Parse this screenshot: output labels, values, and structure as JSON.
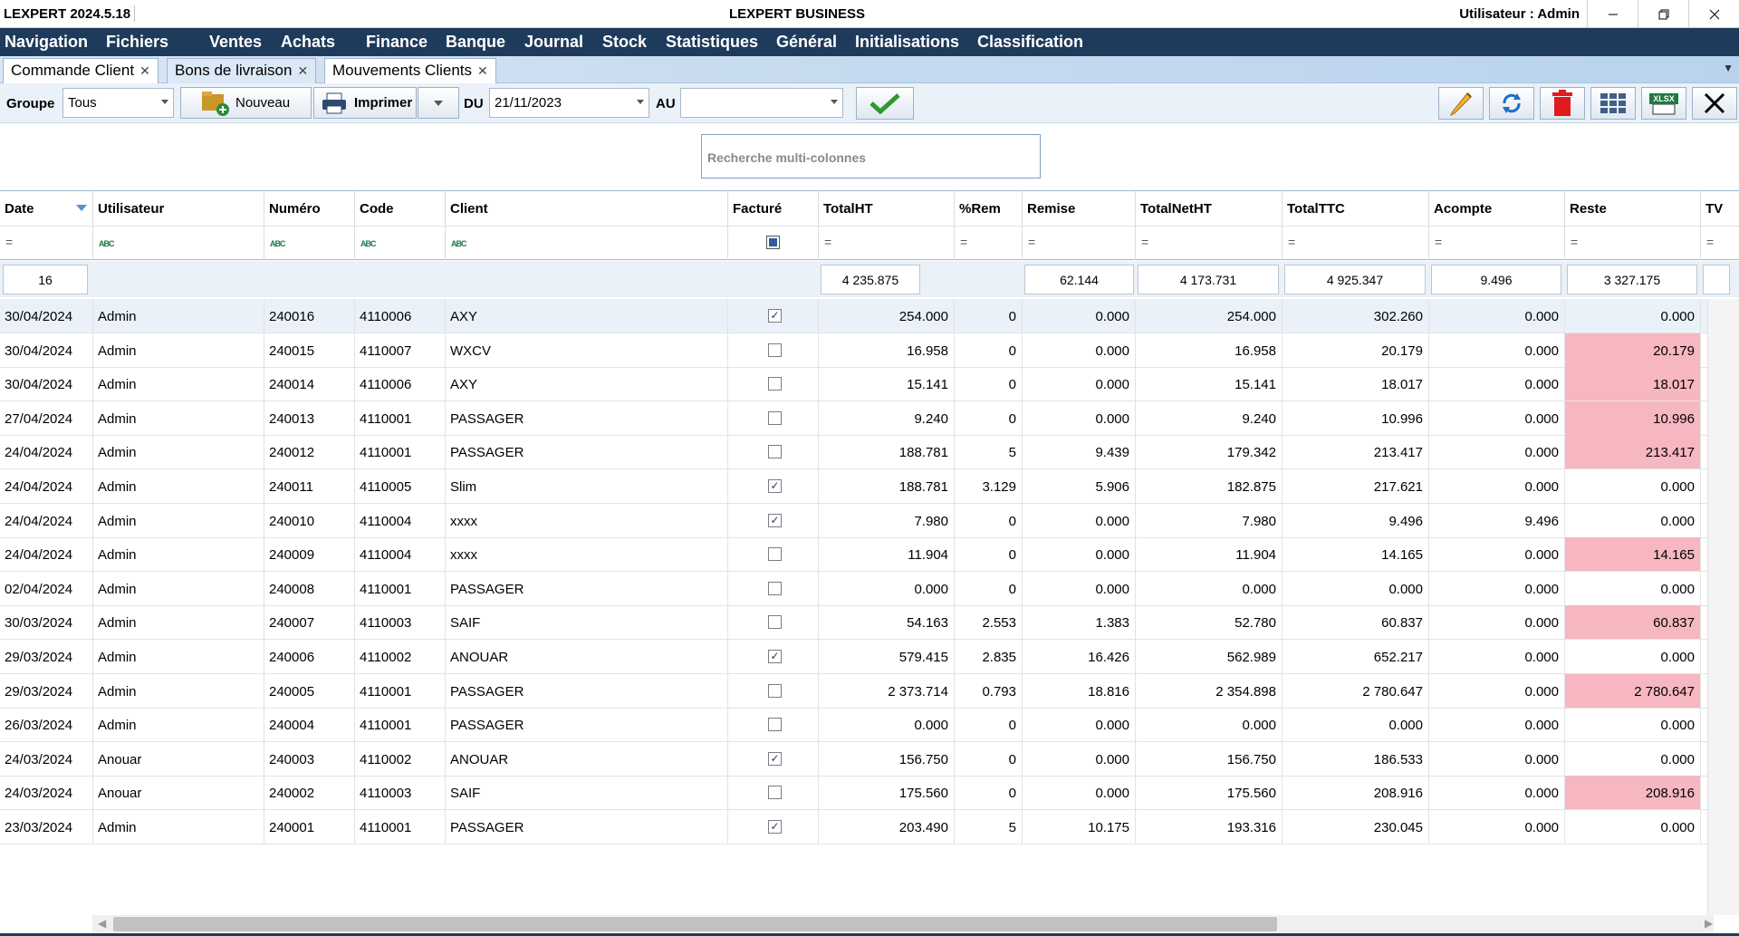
{
  "titlebar": {
    "version": "LEXPERT 2024.5.18",
    "app_name": "LEXPERT BUSINESS",
    "user": "Utilisateur : Admin"
  },
  "menu": [
    "Navigation",
    "Fichiers",
    "Ventes",
    "Achats",
    "Finance",
    "Banque",
    "Journal",
    "Stock",
    "Statistiques",
    "Général",
    "Initialisations",
    "Classification"
  ],
  "tabs": [
    {
      "label": "Commande Client",
      "active": false
    },
    {
      "label": "Bons de livraison",
      "active": true
    },
    {
      "label": "Mouvements Clients",
      "active": false
    }
  ],
  "toolbar": {
    "groupe_label": "Groupe",
    "groupe_value": "Tous",
    "nouveau_label": "Nouveau",
    "imprimer_label": "Imprimer",
    "du_label": "DU",
    "du_value": "21/11/2023",
    "au_label": "AU",
    "au_value": "",
    "icons": [
      "edit-icon",
      "refresh-icon",
      "delete-icon",
      "columns-icon",
      "xlsx-export-icon",
      "close-icon"
    ],
    "xlsx_text": "XLSX",
    "colors": {
      "validate": "#2e9a2e",
      "delete": "#e01b1b",
      "refresh": "#1c6fc1",
      "edit": "#e8a21c"
    }
  },
  "search": {
    "placeholder": "Recherche multi-colonnes"
  },
  "grid": {
    "headers": [
      "Date",
      "Utilisateur",
      "Numéro",
      "Code",
      "Client",
      "Facturé",
      "TotalHT",
      "%Rem",
      "Remise",
      "TotalNetHT",
      "TotalTTC",
      "Acompte",
      "Reste",
      "TV"
    ],
    "filter_symbol": "=",
    "abc_symbol": "ABC",
    "summary": {
      "count": "16",
      "totalht": "4 235.875",
      "remise": "62.144",
      "totalnetht": "4 173.731",
      "totalttc": "4 925.347",
      "acompte": "9.496",
      "reste": "3 327.175"
    },
    "rows": [
      {
        "date": "30/04/2024",
        "user": "Admin",
        "numero": "240016",
        "code": "4110006",
        "client": "AXY",
        "facture": true,
        "totalht": "254.000",
        "rem": "0",
        "remise": "0.000",
        "totalnetht": "254.000",
        "totalttc": "302.260",
        "acompte": "0.000",
        "reste": "0.000",
        "reste_due": false
      },
      {
        "date": "30/04/2024",
        "user": "Admin",
        "numero": "240015",
        "code": "4110007",
        "client": "WXCV",
        "facture": false,
        "totalht": "16.958",
        "rem": "0",
        "remise": "0.000",
        "totalnetht": "16.958",
        "totalttc": "20.179",
        "acompte": "0.000",
        "reste": "20.179",
        "reste_due": true
      },
      {
        "date": "30/04/2024",
        "user": "Admin",
        "numero": "240014",
        "code": "4110006",
        "client": "AXY",
        "facture": false,
        "totalht": "15.141",
        "rem": "0",
        "remise": "0.000",
        "totalnetht": "15.141",
        "totalttc": "18.017",
        "acompte": "0.000",
        "reste": "18.017",
        "reste_due": true
      },
      {
        "date": "27/04/2024",
        "user": "Admin",
        "numero": "240013",
        "code": "4110001",
        "client": "PASSAGER",
        "facture": false,
        "totalht": "9.240",
        "rem": "0",
        "remise": "0.000",
        "totalnetht": "9.240",
        "totalttc": "10.996",
        "acompte": "0.000",
        "reste": "10.996",
        "reste_due": true
      },
      {
        "date": "24/04/2024",
        "user": "Admin",
        "numero": "240012",
        "code": "4110001",
        "client": "PASSAGER",
        "facture": false,
        "totalht": "188.781",
        "rem": "5",
        "remise": "9.439",
        "totalnetht": "179.342",
        "totalttc": "213.417",
        "acompte": "0.000",
        "reste": "213.417",
        "reste_due": true
      },
      {
        "date": "24/04/2024",
        "user": "Admin",
        "numero": "240011",
        "code": "4110005",
        "client": "Slim",
        "facture": true,
        "totalht": "188.781",
        "rem": "3.129",
        "remise": "5.906",
        "totalnetht": "182.875",
        "totalttc": "217.621",
        "acompte": "0.000",
        "reste": "0.000",
        "reste_due": false
      },
      {
        "date": "24/04/2024",
        "user": "Admin",
        "numero": "240010",
        "code": "4110004",
        "client": "xxxx",
        "facture": true,
        "totalht": "7.980",
        "rem": "0",
        "remise": "0.000",
        "totalnetht": "7.980",
        "totalttc": "9.496",
        "acompte": "9.496",
        "reste": "0.000",
        "reste_due": false
      },
      {
        "date": "24/04/2024",
        "user": "Admin",
        "numero": "240009",
        "code": "4110004",
        "client": "xxxx",
        "facture": false,
        "totalht": "11.904",
        "rem": "0",
        "remise": "0.000",
        "totalnetht": "11.904",
        "totalttc": "14.165",
        "acompte": "0.000",
        "reste": "14.165",
        "reste_due": true
      },
      {
        "date": "02/04/2024",
        "user": "Admin",
        "numero": "240008",
        "code": "4110001",
        "client": "PASSAGER",
        "facture": false,
        "totalht": "0.000",
        "rem": "0",
        "remise": "0.000",
        "totalnetht": "0.000",
        "totalttc": "0.000",
        "acompte": "0.000",
        "reste": "0.000",
        "reste_due": false
      },
      {
        "date": "30/03/2024",
        "user": "Admin",
        "numero": "240007",
        "code": "4110003",
        "client": "SAIF",
        "facture": false,
        "totalht": "54.163",
        "rem": "2.553",
        "remise": "1.383",
        "totalnetht": "52.780",
        "totalttc": "60.837",
        "acompte": "0.000",
        "reste": "60.837",
        "reste_due": true
      },
      {
        "date": "29/03/2024",
        "user": "Admin",
        "numero": "240006",
        "code": "4110002",
        "client": "ANOUAR",
        "facture": true,
        "totalht": "579.415",
        "rem": "2.835",
        "remise": "16.426",
        "totalnetht": "562.989",
        "totalttc": "652.217",
        "acompte": "0.000",
        "reste": "0.000",
        "reste_due": false
      },
      {
        "date": "29/03/2024",
        "user": "Admin",
        "numero": "240005",
        "code": "4110001",
        "client": "PASSAGER",
        "facture": false,
        "totalht": "2 373.714",
        "rem": "0.793",
        "remise": "18.816",
        "totalnetht": "2 354.898",
        "totalttc": "2 780.647",
        "acompte": "0.000",
        "reste": "2 780.647",
        "reste_due": true
      },
      {
        "date": "26/03/2024",
        "user": "Admin",
        "numero": "240004",
        "code": "4110001",
        "client": "PASSAGER",
        "facture": false,
        "totalht": "0.000",
        "rem": "0",
        "remise": "0.000",
        "totalnetht": "0.000",
        "totalttc": "0.000",
        "acompte": "0.000",
        "reste": "0.000",
        "reste_due": false
      },
      {
        "date": "24/03/2024",
        "user": "Anouar",
        "numero": "240003",
        "code": "4110002",
        "client": "ANOUAR",
        "facture": true,
        "totalht": "156.750",
        "rem": "0",
        "remise": "0.000",
        "totalnetht": "156.750",
        "totalttc": "186.533",
        "acompte": "0.000",
        "reste": "0.000",
        "reste_due": false
      },
      {
        "date": "24/03/2024",
        "user": "Anouar",
        "numero": "240002",
        "code": "4110003",
        "client": "SAIF",
        "facture": false,
        "totalht": "175.560",
        "rem": "0",
        "remise": "0.000",
        "totalnetht": "175.560",
        "totalttc": "208.916",
        "acompte": "0.000",
        "reste": "208.916",
        "reste_due": true
      },
      {
        "date": "23/03/2024",
        "user": "Admin",
        "numero": "240001",
        "code": "4110001",
        "client": "PASSAGER",
        "facture": true,
        "totalht": "203.490",
        "rem": "5",
        "remise": "10.175",
        "totalnetht": "193.316",
        "totalttc": "230.045",
        "acompte": "0.000",
        "reste": "0.000",
        "reste_due": false
      }
    ]
  }
}
